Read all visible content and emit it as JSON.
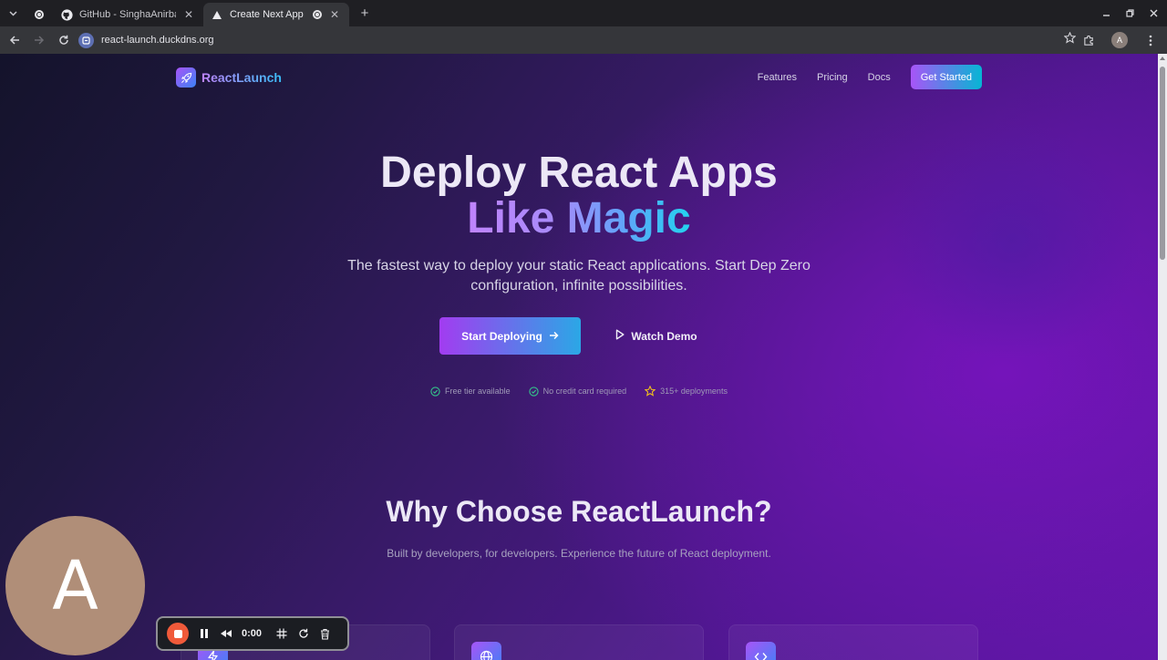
{
  "browser": {
    "tabs": [
      {
        "title": "",
        "pinned": true,
        "icon": "record-icon"
      },
      {
        "title": "GitHub - SinghaAnirban",
        "icon": "github-icon",
        "active": false
      },
      {
        "title": "Create Next App",
        "icon": "vercel-triangle-icon",
        "active": true
      }
    ],
    "url": "react-launch.duckdns.org",
    "profile_initial": "A"
  },
  "site": {
    "brand": "ReactLaunch",
    "nav": [
      "Features",
      "Pricing",
      "Docs"
    ],
    "nav_cta": "Get Started",
    "hero": {
      "title_line1": "Deploy React Apps",
      "title_line2": "Like Magic",
      "subtitle": "The fastest way to deploy your static React applications. Start Dep Zero configuration, infinite possibilities.",
      "primary_cta": "Start Deploying",
      "secondary_cta": "Watch Demo"
    },
    "badges": [
      {
        "text": "Free tier available",
        "icon": "check-circle-icon"
      },
      {
        "text": "No credit card required",
        "icon": "check-circle-icon"
      },
      {
        "text": "315+ deployments",
        "icon": "star-icon"
      }
    ],
    "features_section": {
      "title": "Why Choose ReactLaunch?",
      "subtitle": "Built by developers, for developers. Experience the future of React deployment."
    },
    "feature_icons": [
      "lightning-icon",
      "globe-icon",
      "code-icon"
    ]
  },
  "recorder": {
    "avatar_initial": "A",
    "time": "0:00"
  },
  "colors": {
    "accent_purple": "#a855f7",
    "accent_cyan": "#06b6d4",
    "record_red": "#f05a3a"
  }
}
